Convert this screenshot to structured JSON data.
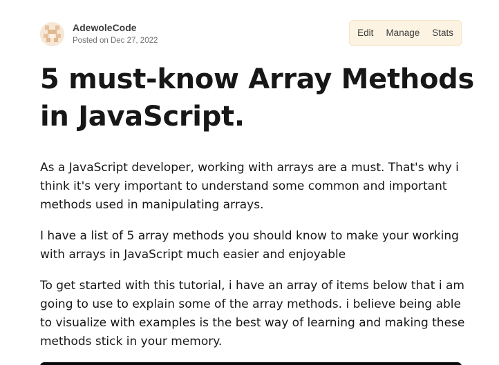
{
  "author": {
    "name": "AdewoleCode",
    "date": "Posted on Dec 27, 2022"
  },
  "actions": {
    "edit_label": "Edit",
    "manage_label": "Manage",
    "stats_label": "Stats"
  },
  "article": {
    "title": "5 must-know Array Methods in JavaScript.",
    "paragraphs": [
      "As a JavaScript developer, working with arrays are a must. That's why i think it's very important to understand some common and important methods used in manipulating arrays.",
      "I have a list of 5 array methods you should know to make your working with arrays in JavaScript much easier and enjoyable",
      "To get started with this tutorial, i have an array of items below that i am going to use to explain some of the array methods. i believe being able to visualize with examples is the best way of learning and making these methods stick in your memory."
    ]
  },
  "colors": {
    "actions_bg": "#fdf3e2",
    "text": "#171717",
    "muted": "#717171",
    "code_block": "#08090a"
  }
}
